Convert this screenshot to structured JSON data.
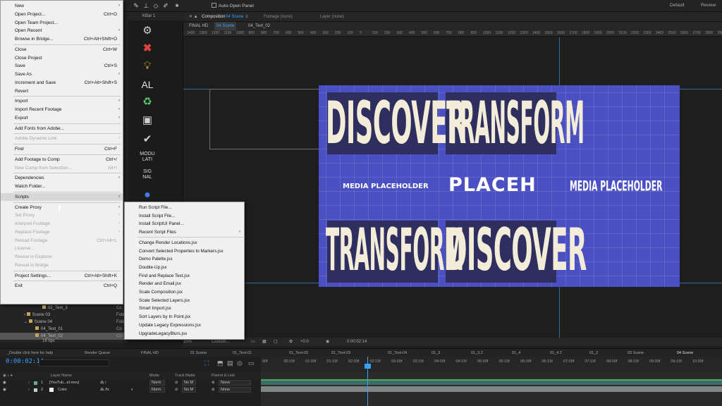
{
  "toolbar": {
    "auto_open_label": "Auto-Open Panel",
    "workspace_default": "Default",
    "workspace_review": "Review"
  },
  "effects_panel": {
    "title": "KBar 1",
    "text_al": "AL",
    "text_modulati": "MODU LATI",
    "text_signal": "SIG NAL"
  },
  "viewer": {
    "comp_tab_label": "Composition",
    "comp_name": "04 Scene",
    "footage_tab": "Footage (none)",
    "layer_tab": "Layer (none)",
    "breadcrumb": [
      "FINAL HD",
      "04 Scene",
      "04_Text_02"
    ],
    "ruler_ticks": [
      "1400",
      "1300",
      "1200",
      "1100",
      "1000",
      "900",
      "800",
      "700",
      "600",
      "500",
      "400",
      "300",
      "200",
      "100",
      "0",
      "100",
      "200",
      "300",
      "400",
      "500",
      "600",
      "700",
      "800",
      "900",
      "1000",
      "1100",
      "1200",
      "1300",
      "1400",
      "1500",
      "1600",
      "1700",
      "1800",
      "1900",
      "2000",
      "2100",
      "2200",
      "2300",
      "2400",
      "2500",
      "2600",
      "2700",
      "2800",
      "2900"
    ],
    "zoom": "25%",
    "res": "Custom...",
    "exposure": "+0.0",
    "footer_timecode": "0:00:02:14",
    "art": {
      "word_1": "DISCOVER",
      "word_2": "TRANSFORM",
      "word_3": "TRANSFORM",
      "word_4": "DISCOVER",
      "placeholder_left": "MEDIA PLACEHOLDER",
      "placeholder_center": "PLACEH",
      "placeholder_right": "MEDIA PLACEHOLDER"
    }
  },
  "main_menu": {
    "items": [
      {
        "label": "New",
        "shortcut": "",
        "arrow": "›",
        "disabled": false
      },
      {
        "label": "Open Project...",
        "shortcut": "Ctrl+O",
        "arrow": "",
        "disabled": false
      },
      {
        "label": "Open Team Project...",
        "shortcut": "",
        "arrow": "",
        "disabled": false
      },
      {
        "label": "Open Recent",
        "shortcut": "",
        "arrow": "›",
        "disabled": false
      },
      {
        "label": "Browse in Bridge...",
        "shortcut": "Ctrl+Alt+Shift+O",
        "arrow": "",
        "disabled": false
      },
      {
        "label": "Close",
        "shortcut": "Ctrl+W",
        "arrow": "",
        "disabled": false
      },
      {
        "label": "Close Project",
        "shortcut": "",
        "arrow": "",
        "disabled": false
      },
      {
        "label": "Save",
        "shortcut": "Ctrl+S",
        "arrow": "",
        "disabled": false
      },
      {
        "label": "Save As",
        "shortcut": "",
        "arrow": "›",
        "disabled": false
      },
      {
        "label": "Increment and Save",
        "shortcut": "Ctrl+Alt+Shift+S",
        "arrow": "",
        "disabled": false
      },
      {
        "label": "Revert",
        "shortcut": "",
        "arrow": "",
        "disabled": false
      },
      {
        "label": "Import",
        "shortcut": "",
        "arrow": "›",
        "disabled": false
      },
      {
        "label": "Import Recent Footage",
        "shortcut": "",
        "arrow": "›",
        "disabled": false
      },
      {
        "label": "Export",
        "shortcut": "",
        "arrow": "›",
        "disabled": false
      },
      {
        "label": "Add Fonts from Adobe...",
        "shortcut": "",
        "arrow": "",
        "disabled": false
      },
      {
        "label": "Adobe Dynamic Link",
        "shortcut": "",
        "arrow": "›",
        "disabled": true
      },
      {
        "label": "Find",
        "shortcut": "Ctrl+F",
        "arrow": "",
        "disabled": false
      },
      {
        "label": "Add Footage to Comp",
        "shortcut": "Ctrl+/",
        "arrow": "",
        "disabled": false
      },
      {
        "label": "New Comp from Selection...",
        "shortcut": "Alt+\\",
        "arrow": "",
        "disabled": true
      },
      {
        "label": "Dependencies",
        "shortcut": "",
        "arrow": "›",
        "disabled": false
      },
      {
        "label": "Watch Folder...",
        "shortcut": "",
        "arrow": "",
        "disabled": false
      },
      {
        "label": "Scripts",
        "shortcut": "",
        "arrow": "›",
        "disabled": false
      },
      {
        "label": "Create Proxy",
        "shortcut": "",
        "arrow": "›",
        "disabled": false
      },
      {
        "label": "Set Proxy",
        "shortcut": "",
        "arrow": "›",
        "disabled": true
      },
      {
        "label": "Interpret Footage",
        "shortcut": "",
        "arrow": "›",
        "disabled": true
      },
      {
        "label": "Replace Footage",
        "shortcut": "",
        "arrow": "›",
        "disabled": true
      },
      {
        "label": "Reload Footage",
        "shortcut": "Ctrl+Alt+L",
        "arrow": "",
        "disabled": true
      },
      {
        "label": "License...",
        "shortcut": "",
        "arrow": "",
        "disabled": true
      },
      {
        "label": "Reveal in Explorer",
        "shortcut": "",
        "arrow": "",
        "disabled": true
      },
      {
        "label": "Reveal in Bridge",
        "shortcut": "",
        "arrow": "",
        "disabled": true
      },
      {
        "label": "Project Settings...",
        "shortcut": "Ctrl+Alt+Shift+K",
        "arrow": "",
        "disabled": false
      },
      {
        "label": "Exit",
        "shortcut": "Ctrl+Q",
        "arrow": "",
        "disabled": false
      }
    ]
  },
  "scripts_menu": {
    "items": [
      {
        "label": "Run Script File...",
        "arrow": ""
      },
      {
        "label": "Install Script File...",
        "arrow": ""
      },
      {
        "label": "Install ScriptUI Panel...",
        "arrow": ""
      },
      {
        "label": "Recent Script Files",
        "arrow": "›"
      },
      {
        "label": "Change Render Locations.jsx",
        "arrow": ""
      },
      {
        "label": "Convert Selected Properties to Markers.jsx",
        "arrow": ""
      },
      {
        "label": "Demo Palette.jsx",
        "arrow": ""
      },
      {
        "label": "Double-Up.jsx",
        "arrow": ""
      },
      {
        "label": "Find and Replace Text.jsx",
        "arrow": ""
      },
      {
        "label": "Render and Email.jsx",
        "arrow": ""
      },
      {
        "label": "Scale Composition.jsx",
        "arrow": ""
      },
      {
        "label": "Scale Selected Layers.jsx",
        "arrow": ""
      },
      {
        "label": "Smart Import.jsx",
        "arrow": ""
      },
      {
        "label": "Sort Layers by In Point.jsx",
        "arrow": ""
      },
      {
        "label": "Update Legacy Expressions.jsx",
        "arrow": ""
      },
      {
        "label": "UpgradeLegacyBlurs.jsx",
        "arrow": ""
      }
    ]
  },
  "project_panel": {
    "rows": [
      {
        "name": "02_Text_3",
        "type": "Co"
      },
      {
        "name": "Scene 03",
        "type": "Fold"
      },
      {
        "name": "Scene 04",
        "type": "Fold"
      },
      {
        "name": "04_Text_01",
        "type": "Co"
      },
      {
        "name": "04_Text_02",
        "type": "Co"
      }
    ],
    "bpc": "16 bpc"
  },
  "timeline": {
    "tabs": [
      "_Double click here for help",
      "Render Queue",
      "FINAL HD",
      "01 Scene",
      "01_Text-01",
      "01_Text-02",
      "01_Text-03",
      "01_Text-04",
      "01_3",
      "01_3.2",
      "01_4",
      "01_4.2",
      "01_2",
      "03 Scene",
      "04 Scene"
    ],
    "timecode": "0:00:02:14",
    "ruler": [
      "00f",
      "00:15f",
      "01:00f",
      "01:15f",
      "02:00f",
      "02:15f",
      "03:00f",
      "03:15f",
      "04:00f",
      "04:15f",
      "05:00f",
      "05:15f",
      "06:00f",
      "06:15f",
      "07:00f",
      "07:15f",
      "08:00f",
      "08:15f",
      "09:00f",
      "09:15f",
      "10:00f"
    ],
    "header": {
      "layer_name": "Layer Name",
      "mode": "Mode",
      "track_matte": "Track Matte",
      "parent": "Parent & Link"
    },
    "layers": [
      {
        "num": "1",
        "name": "[YouTub...el.mov]",
        "mode": "Norm",
        "matte": "No M",
        "parent": "None"
      },
      {
        "num": "2",
        "name": "Color",
        "mode": "Norm",
        "matte": "No M",
        "parent": "None"
      }
    ]
  }
}
